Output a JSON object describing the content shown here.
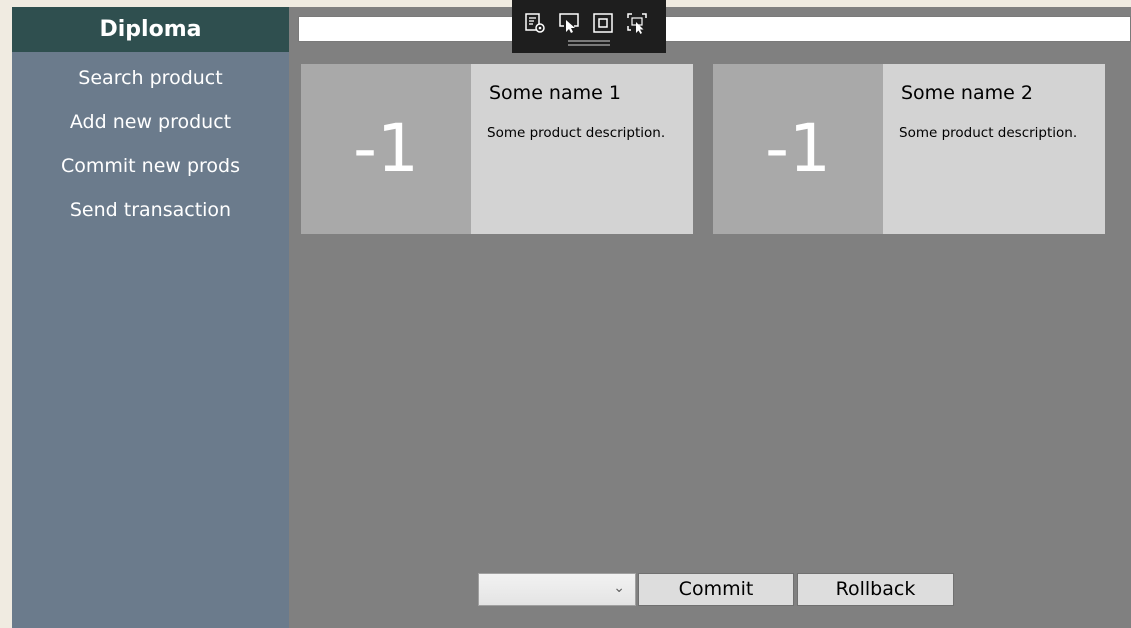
{
  "sidebar": {
    "title": "Diploma",
    "items": [
      {
        "label": "Search product"
      },
      {
        "label": "Add new product"
      },
      {
        "label": "Commit new prods"
      },
      {
        "label": "Send transaction"
      }
    ]
  },
  "search": {
    "value": "",
    "placeholder": ""
  },
  "dev_toolbar": {
    "icons": [
      "live-visual-tree-icon",
      "select-element-icon",
      "display-layout-adorners-icon",
      "track-focused-element-icon"
    ]
  },
  "products": [
    {
      "count": "-1",
      "name": "Some name 1",
      "description": "Some product description."
    },
    {
      "count": "-1",
      "name": "Some name 2",
      "description": "Some product description."
    }
  ],
  "footer": {
    "select_value": "",
    "commit_label": "Commit",
    "rollback_label": "Rollback"
  },
  "colors": {
    "sidebar_header_bg": "#2f4f4f",
    "sidebar_bg": "#6b7b8c",
    "content_bg": "#808080",
    "card_bg": "#d3d3d3",
    "card_count_bg": "#a9a9a9"
  }
}
